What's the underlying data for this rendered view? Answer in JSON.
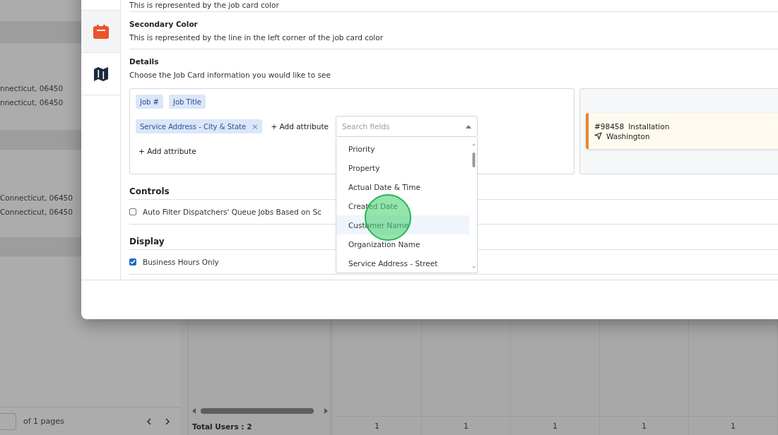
{
  "background": {
    "address_rows": [
      "nnecticut, 06450",
      "nnecticut, 06450",
      "Connecticut, 06450",
      "Connecticut, 06450"
    ],
    "pagination": {
      "label": "of 1 pages"
    },
    "total_users": "Total Users : 2",
    "column_totals": [
      "1",
      "1",
      "1",
      "1",
      "1"
    ]
  },
  "modal": {
    "rail": [
      {
        "kind": "calendar",
        "selected": true
      },
      {
        "kind": "map",
        "selected": false
      }
    ],
    "intro": "This is represented by the job card color",
    "sections": [
      {
        "title": "Secondary Color",
        "description": "This is represented by the line in the left corner of the job card color"
      }
    ],
    "details": {
      "title": "Details",
      "description": "Choose the Job Card information you would like to see",
      "rows": [
        {
          "chips": [
            {
              "label": "Job #"
            },
            {
              "label": "Job Title"
            }
          ]
        },
        {
          "chips": [
            {
              "label": "Service Address - City & State",
              "remove": "×"
            }
          ],
          "add_label": "+ Add attribute",
          "dropdown": {
            "placeholder": "Search fields",
            "options": [
              {
                "label": "Priority",
                "highlighted": false
              },
              {
                "label": "Property",
                "highlighted": false
              },
              {
                "label": "Actual Date & Time",
                "highlighted": false
              },
              {
                "label": "Created Date",
                "highlighted": false
              },
              {
                "label": "Customer Name",
                "highlighted": true
              },
              {
                "label": "Organization Name",
                "highlighted": false
              },
              {
                "label": "Service Address - Street",
                "highlighted": false
              }
            ]
          }
        },
        {
          "add_label": "+ Add attribute"
        }
      ],
      "preview": {
        "job_number": "#98458",
        "title": "Installation",
        "location": "Washington",
        "color": "#e8892b"
      }
    },
    "controls": {
      "title": "Controls",
      "items": [
        {
          "label": "Auto Filter Dispatchers' Queue Jobs Based on Sc",
          "checked": false
        }
      ]
    },
    "display": {
      "title": "Display",
      "items": [
        {
          "label": "Business Hours Only",
          "checked": true
        }
      ]
    }
  }
}
